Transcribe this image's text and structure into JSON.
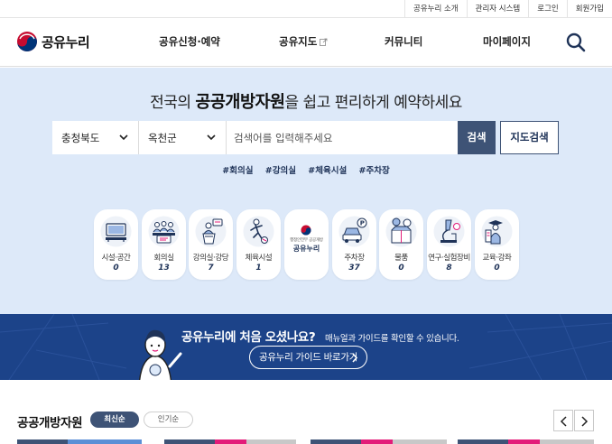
{
  "util_links": [
    "공유누리 소개",
    "관리자 시스템",
    "로그인",
    "회원가입"
  ],
  "brand": {
    "name": "공유누리"
  },
  "nav": [
    "공유신청·예약",
    "공유지도",
    "커뮤니티",
    "마이페이지"
  ],
  "hero": {
    "title_pre": "전국의 ",
    "title_bold": "공공개방자원",
    "title_post": "을 쉽고 편리하게 예약하세요"
  },
  "search": {
    "region": "충청북도",
    "district": "옥천군",
    "placeholder": "검색어를 입력해주세요",
    "submit_label": "검색",
    "map_label": "지도검색"
  },
  "tags": [
    "#회의실",
    "#강의실",
    "#체육시설",
    "#주차장"
  ],
  "categories": [
    {
      "label": "시설·공간",
      "count": "0",
      "icon": "facility-icon"
    },
    {
      "label": "회의실",
      "count": "13",
      "icon": "meeting-room-icon"
    },
    {
      "label": "강의실·강당",
      "count": "7",
      "icon": "lecture-room-icon"
    },
    {
      "label": "체육시설",
      "count": "1",
      "icon": "sports-icon"
    },
    {
      "label": "주차장",
      "count": "37",
      "icon": "parking-icon"
    },
    {
      "label": "물품",
      "count": "0",
      "icon": "goods-icon"
    },
    {
      "label": "연구·실험장비",
      "count": "8",
      "icon": "lab-equipment-icon"
    },
    {
      "label": "교육·강좌",
      "count": "0",
      "icon": "education-icon"
    }
  ],
  "center_badge": {
    "small": "행정안전부 공공개방",
    "big": "공유누리"
  },
  "guide": {
    "question": "공유누리에 처음 오셨나요?",
    "desc": "매뉴얼과 가이드를 확인할 수 있습니다.",
    "link_label": "공유누리 가이드 바로가기"
  },
  "resources": {
    "title": "공공개방자원",
    "sort_active": "최신순",
    "sort_inactive": "인기순"
  },
  "colors": {
    "navy": "#1c4389",
    "accent": "#3e5376",
    "hero_bg": "#dde9f9",
    "pink": "#e31c79"
  }
}
